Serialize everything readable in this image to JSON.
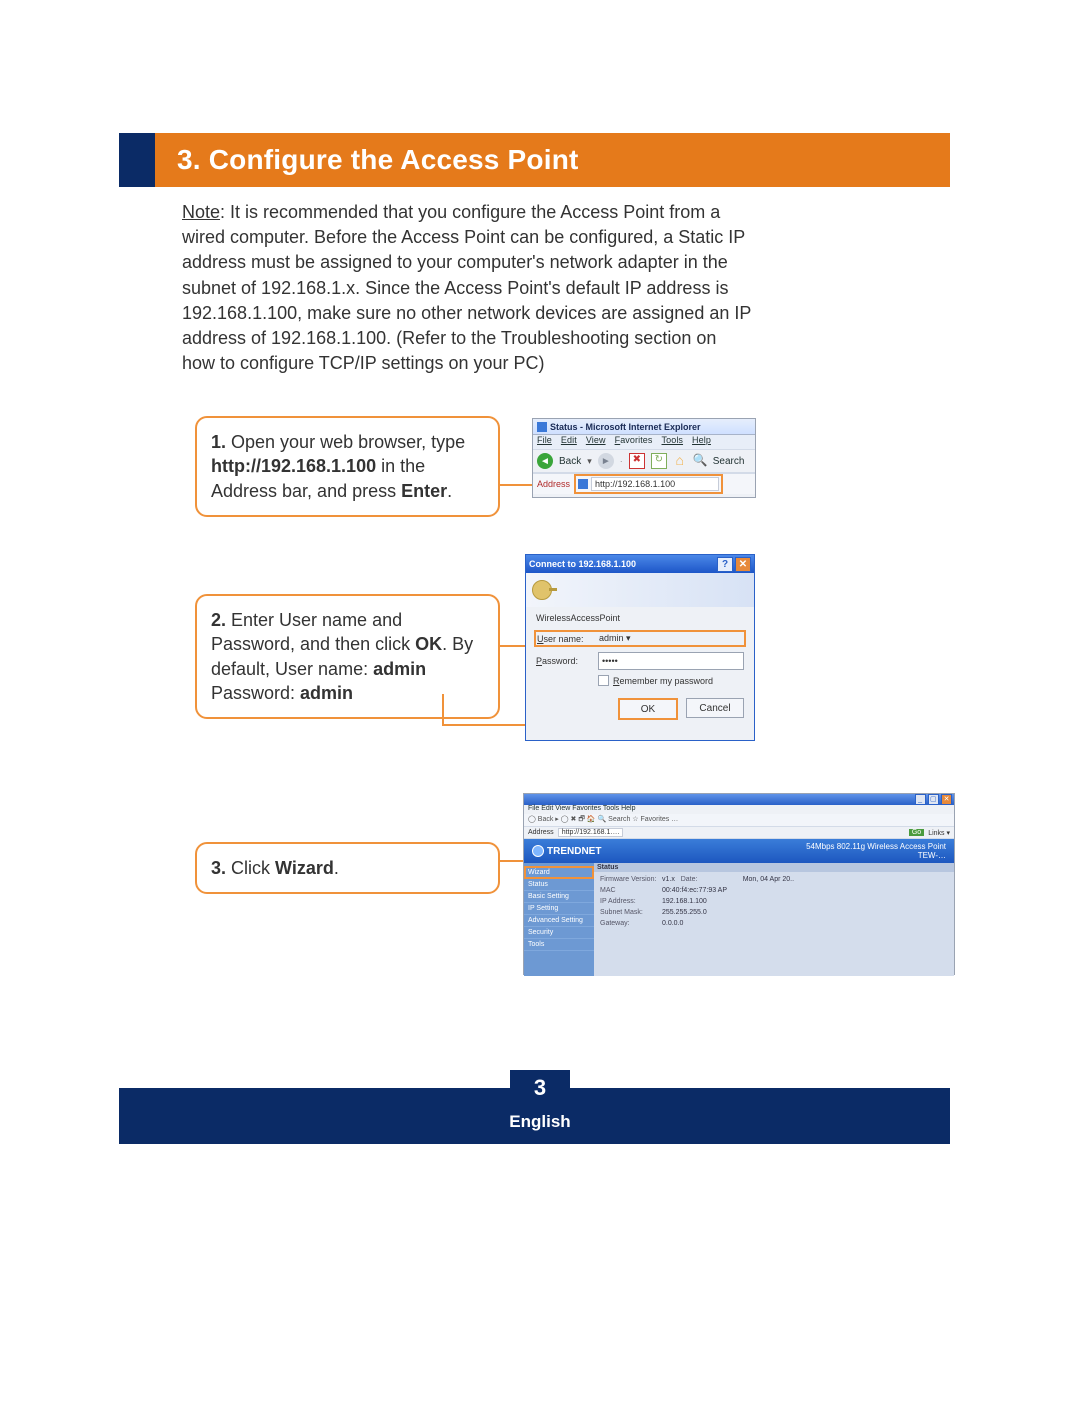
{
  "section": {
    "number": "3.",
    "title": "Configure the Access Point"
  },
  "note": {
    "label": "Note",
    "text": ": It is recommended that you configure the Access Point from a wired computer.  Before the Access Point can be configured, a Static IP address must be assigned to your computer's network adapter in the subnet of 192.168.1.x.  Since the Access Point's default IP address is 192.168.1.100, make sure no other network devices are assigned an IP address of 192.168.1.100.  (Refer to the Troubleshooting section on how to configure TCP/IP settings on your PC)"
  },
  "steps": {
    "s1": {
      "num": "1.",
      "t1": " Open your web browser, type ",
      "url": "http://192.168.1.100",
      "t2": " in the Address bar, and press ",
      "enter": "Enter",
      "t3": "."
    },
    "s2": {
      "num": "2.",
      "t1": " Enter User name and Password, and then click ",
      "ok": "OK",
      "t2": ". By default, User name: ",
      "u": "admin",
      "t3": " Password: ",
      "p": "admin"
    },
    "s3": {
      "num": "3.",
      "t1": " Click ",
      "wiz": "Wizard",
      "t2": "."
    }
  },
  "ie": {
    "title": "Status - Microsoft Internet Explorer",
    "menu": {
      "file": "File",
      "edit": "Edit",
      "view": "View",
      "fav": "Favorites",
      "tools": "Tools",
      "help": "Help"
    },
    "back": "Back",
    "search": "Search",
    "address_label": "Address",
    "url": "http://192.168.1.100"
  },
  "login": {
    "title": "Connect to 192.168.1.100",
    "realm": "WirelessAccessPoint",
    "user_label_u": "U",
    "user_label_rest": "ser name:",
    "pass_label_u": "P",
    "pass_label_rest": "assword:",
    "user_value": "admin",
    "pass_value": "•••••",
    "remember_u": "R",
    "remember_rest": "emember my password",
    "ok": "OK",
    "cancel": "Cancel"
  },
  "status": {
    "window_title": "",
    "menu_text": "File  Edit  View  Favorites  Tools  Help",
    "toolbar_text": "◯ Back  ▸  ◯  ✖ 🗗 🏠  🔍 Search  ☆ Favorites  …",
    "addr_value": "http://192.168.1….",
    "go": "Go",
    "brand": "TRENDNET",
    "tagline": "54Mbps 802.11g Wireless Access Point",
    "model": "TEW-…",
    "nav": [
      "Wizard",
      "Status",
      "Basic Setting",
      "IP Setting",
      "Advanced Setting",
      "Security",
      "Tools"
    ],
    "content_header": "Status",
    "firmware": "Firmware Version:",
    "firmware_v": "v1.x",
    "date": "Date:",
    "date_v": "Mon, 04 Apr 20..",
    "mac": "MAC",
    "mac_v": "00:40:f4:ec:77:93 AP",
    "ip": "IP Address:",
    "ip_v": "192.168.1.100",
    "mask": "Subnet Mask:",
    "mask_v": "255.255.255.0",
    "gw": "Gateway:",
    "gw_v": "0.0.0.0"
  },
  "footer": {
    "page": "3",
    "lang": "English"
  }
}
